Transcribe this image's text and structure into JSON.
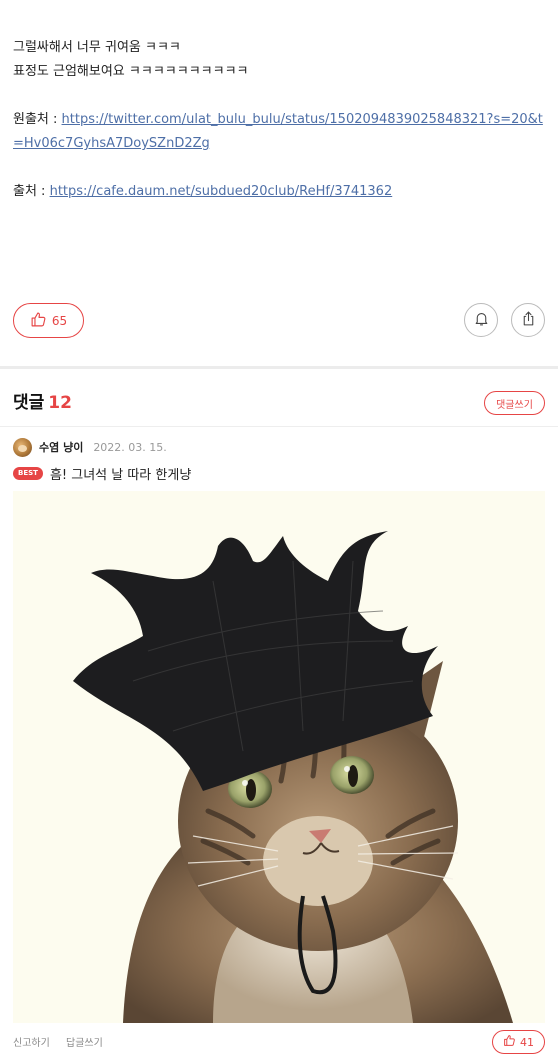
{
  "post": {
    "line1": "그럴싸해서 너무 귀여움 ㅋㅋㅋ",
    "line2": "표정도 근엄해보여요 ㅋㅋㅋㅋㅋㅋㅋㅋㅋㅋ",
    "source_label": "원출처 : ",
    "source_url": "https://twitter.com/ulat_bulu_bulu/status/1502094839025848321?s=20&t=Hv06c7GyhsA7DoySZnD2Zg",
    "origin_label": "출처 : ",
    "origin_url": "https://cafe.daum.net/subdued20club/ReHf/3741362"
  },
  "actions": {
    "like_count": "65",
    "icons": [
      "thumbs-up-icon",
      "bell-icon",
      "share-icon"
    ]
  },
  "comments": {
    "title": "댓글",
    "count": "12",
    "write_label": "댓글쓰기",
    "items": [
      {
        "nickname": "수염 냥이",
        "date": "2022. 03. 15.",
        "badge": "BEST",
        "text": "흠! 그녀석 날 따라 한게냥",
        "report_label": "신고하기",
        "reply_label": "답글쓰기",
        "like_count": "41"
      }
    ]
  },
  "colors": {
    "accent": "#e64545",
    "link": "#4e6fa7",
    "image_bg": "#fdfcef"
  }
}
